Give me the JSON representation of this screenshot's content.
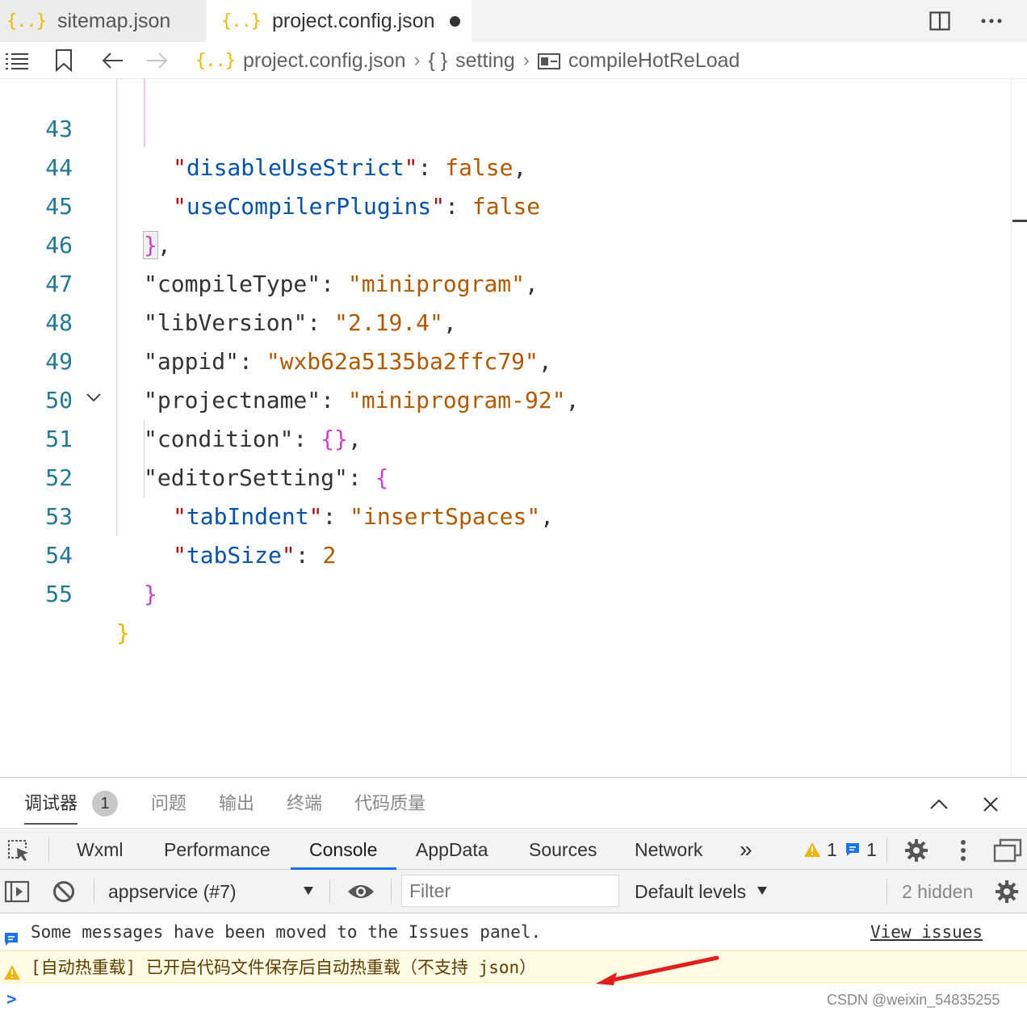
{
  "tabs": [
    {
      "label": "sitemap.json",
      "icon": "json-icon"
    },
    {
      "label": "project.config.json",
      "icon": "json-icon",
      "modified": true
    }
  ],
  "tab_icon_text": "{..}",
  "breadcrumb": {
    "file": "project.config.json",
    "object_label": "setting",
    "object_icon": "{ }",
    "leaf_label": "compileHotReLoad"
  },
  "editor": {
    "lines": [
      {
        "n": "43"
      },
      {
        "n": "44"
      },
      {
        "n": "45"
      },
      {
        "n": "46"
      },
      {
        "n": "47"
      },
      {
        "n": "48"
      },
      {
        "n": "49"
      },
      {
        "n": "50"
      },
      {
        "n": "51"
      },
      {
        "n": "52"
      },
      {
        "n": "53"
      },
      {
        "n": "54"
      },
      {
        "n": "55"
      }
    ],
    "keys": {
      "disableUseStrict": "disableUseStrict",
      "useCompilerPlugins": "useCompilerPlugins",
      "compileType": "compileType",
      "libVersion": "libVersion",
      "appid": "appid",
      "projectname": "projectname",
      "condition": "condition",
      "editorSetting": "editorSetting",
      "tabIndent": "tabIndent",
      "tabSize": "tabSize"
    },
    "values": {
      "disableUseStrict": "false",
      "useCompilerPlugins": "false",
      "compileType": "miniprogram",
      "libVersion": "2.19.4",
      "appid": "wxb62a5135ba2ffc79",
      "projectname": "miniprogram-92",
      "tabIndent": "insertSpaces",
      "tabSize": "2"
    }
  },
  "panel": {
    "tabs": [
      "调试器",
      "问题",
      "输出",
      "终端",
      "代码质量"
    ],
    "debugger_badge": "1"
  },
  "devtools": {
    "tabs": [
      "Wxml",
      "Performance",
      "Console",
      "AppData",
      "Sources",
      "Network"
    ],
    "active_tab": "Console",
    "more": "»",
    "warning_count": "1",
    "info_count": "1"
  },
  "console_toolbar": {
    "context": "appservice (#7)",
    "filter_placeholder": "Filter",
    "levels": "Default levels",
    "hidden": "2 hidden"
  },
  "console": {
    "info_message": "Some messages have been moved to the Issues panel.",
    "view_issues": "View issues",
    "warn_message": "[自动热重载] 已开启代码文件保存后自动热重载（不支持 json）",
    "prompt": ">"
  },
  "watermark": "CSDN @weixin_54835255",
  "colors": {
    "accent": "#1a73e8",
    "json_icon": "#e8b900",
    "line_number": "#237893",
    "warning_bg": "#fffbe5",
    "annotation_arrow": "#e0201c"
  }
}
